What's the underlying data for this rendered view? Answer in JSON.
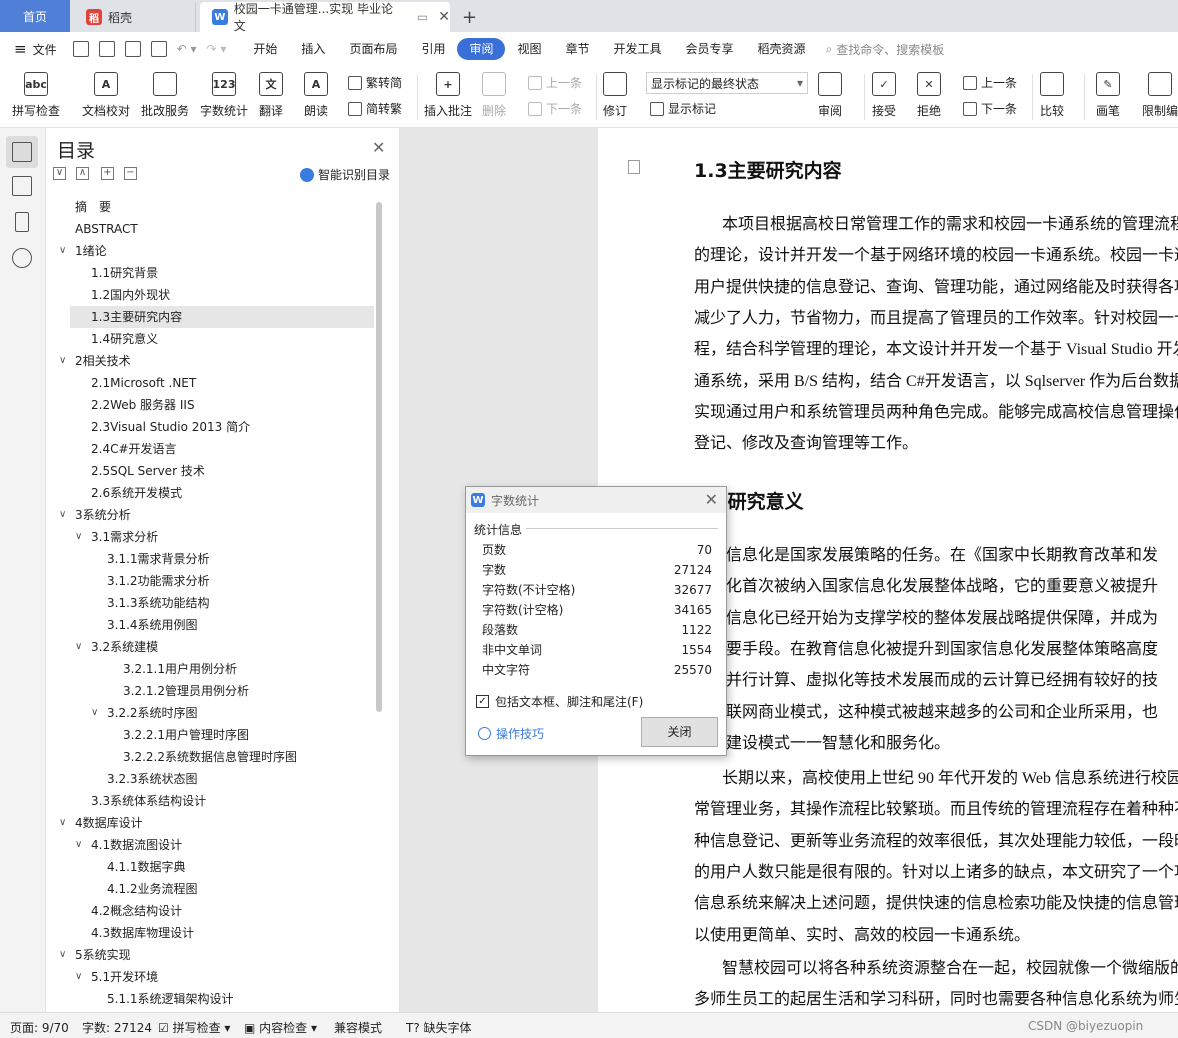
{
  "tabs": {
    "home": "首页",
    "daoke": "稻壳",
    "doc": "校园一卡通管理...实现 毕业论文",
    "add": "+"
  },
  "menubar": {
    "file": "文件",
    "items": [
      "开始",
      "插入",
      "页面布局",
      "引用",
      "审阅",
      "视图",
      "章节",
      "开发工具",
      "会员专享",
      "稻壳资源"
    ],
    "active": "审阅",
    "search": "查找命令、搜索模板"
  },
  "ribbon": {
    "spell": "拼写检查",
    "proof": "文档校对",
    "review_service": "批改服务",
    "word_count": "字数统计",
    "translate": "翻译",
    "read_aloud": "朗读",
    "to_traditional": "繁转简",
    "to_simplified": "简转繁",
    "insert_comment": "插入批注",
    "delete": "删除",
    "prev_comment": "上一条",
    "next_comment": "下一条",
    "track": "修订",
    "markup_select": "显示标记的最终状态",
    "show_markup": "显示标记",
    "review": "审阅",
    "accept": "接受",
    "reject": "拒绝",
    "prev": "上一条",
    "next": "下一条",
    "compare": "比较",
    "pen": "画笔",
    "restrict": "限制编"
  },
  "nav": {
    "title": "目录",
    "smart": "智能识别目录",
    "items": [
      {
        "text": "摘　要",
        "level": 0,
        "arrow": ""
      },
      {
        "text": "ABSTRACT",
        "level": 0,
        "arrow": ""
      },
      {
        "text": "1绪论",
        "level": 0,
        "arrow": "∨"
      },
      {
        "text": "1.1研究背景",
        "level": 1,
        "arrow": ""
      },
      {
        "text": "1.2国内外现状",
        "level": 1,
        "arrow": ""
      },
      {
        "text": "1.3主要研究内容",
        "level": 1,
        "arrow": "",
        "selected": true
      },
      {
        "text": "1.4研究意义",
        "level": 1,
        "arrow": ""
      },
      {
        "text": "2相关技术",
        "level": 0,
        "arrow": "∨"
      },
      {
        "text": "2.1Microsoft .NET",
        "level": 1,
        "arrow": ""
      },
      {
        "text": "2.2Web 服务器 IIS",
        "level": 1,
        "arrow": ""
      },
      {
        "text": "2.3Visual Studio 2013 简介",
        "level": 1,
        "arrow": ""
      },
      {
        "text": "2.4C#开发语言",
        "level": 1,
        "arrow": ""
      },
      {
        "text": "2.5SQL Server 技术",
        "level": 1,
        "arrow": ""
      },
      {
        "text": "2.6系统开发模式",
        "level": 1,
        "arrow": ""
      },
      {
        "text": "3系统分析",
        "level": 0,
        "arrow": "∨"
      },
      {
        "text": "3.1需求分析",
        "level": 1,
        "arrow": "∨"
      },
      {
        "text": "3.1.1需求背景分析",
        "level": 2,
        "arrow": ""
      },
      {
        "text": "3.1.2功能需求分析",
        "level": 2,
        "arrow": ""
      },
      {
        "text": "3.1.3系统功能结构",
        "level": 2,
        "arrow": ""
      },
      {
        "text": "3.1.4系统用例图",
        "level": 2,
        "arrow": ""
      },
      {
        "text": "3.2系统建模",
        "level": 1,
        "arrow": "∨"
      },
      {
        "text": "3.2.1.1用户用例分析",
        "level": 3,
        "arrow": ""
      },
      {
        "text": "3.2.1.2管理员用例分析",
        "level": 3,
        "arrow": ""
      },
      {
        "text": "3.2.2系统时序图",
        "level": 2,
        "arrow": "∨"
      },
      {
        "text": "3.2.2.1用户管理时序图",
        "level": 3,
        "arrow": ""
      },
      {
        "text": "3.2.2.2系统数据信息管理时序图",
        "level": 3,
        "arrow": ""
      },
      {
        "text": "3.2.3系统状态图",
        "level": 2,
        "arrow": ""
      },
      {
        "text": "3.3系统体系结构设计",
        "level": 1,
        "arrow": ""
      },
      {
        "text": "4数据库设计",
        "level": 0,
        "arrow": "∨"
      },
      {
        "text": "4.1数据流图设计",
        "level": 1,
        "arrow": "∨"
      },
      {
        "text": "4.1.1数据字典",
        "level": 2,
        "arrow": ""
      },
      {
        "text": "4.1.2业务流程图",
        "level": 2,
        "arrow": ""
      },
      {
        "text": "4.2概念结构设计",
        "level": 1,
        "arrow": ""
      },
      {
        "text": "4.3数据库物理设计",
        "level": 1,
        "arrow": ""
      },
      {
        "text": "5系统实现",
        "level": 0,
        "arrow": "∨"
      },
      {
        "text": "5.1开发环境",
        "level": 1,
        "arrow": "∨"
      },
      {
        "text": "5.1.1系统逻辑架构设计",
        "level": 2,
        "arrow": ""
      }
    ]
  },
  "doc": {
    "heading1": "1.3主要研究内容",
    "para1": [
      "本项目根据高校日常管理工作的需求和校园一卡通系统的管理流程",
      "的理论，设计并开发一个基于网络环境的校园一卡通系统。校园一卡通",
      "用户提供快捷的信息登记、查询、管理功能，通过网络能及时获得各项",
      "减少了人力，节省物力，而且提高了管理员的工作效率。针对校园一卡",
      "程，结合科学管理的理论，本文设计并开发一个基于 Visual Studio 开发",
      "通系统，采用 B/S 结构，结合 C#开发语言，以 Sqlserver 作为后台数据",
      "实现通过用户和系统管理员两种角色完成。能够完成高校信息管理操作",
      "登记、修改及查询管理等工作。"
    ],
    "heading2": "1.4研究意义",
    "para2": [
      "教育信息化是国家发展策略的任务。在《国家中长期教育改革和发",
      "信息化首次被纳入国家信息化发展整体战略，它的重要意义被提升",
      "教育信息化已经开始为支撑学校的整体发展战略提供保障，并成为",
      "的重要手段。在教育信息化被提升到国家信息化发展整体策略高度",
      "算、并行计算、虚拟化等技术发展而成的云计算已经拥有较好的技",
      "的互联网商业模式，这种模式被越来越多的公司和企业所采用，也",
      "新的建设模式一一智慧化和服务化。"
    ],
    "para3": [
      "长期以来，高校使用上世纪 90 年代开发的 Web 信息系统进行校园",
      "常管理业务，其操作流程比较繁琐。而且传统的管理流程存在着种种不",
      "种信息登记、更新等业务流程的效率很低，其次处理能力较低，一段时",
      "的用户人数只能是很有限的。针对以上诸多的缺点，本文研究了一个功",
      "信息系统来解决上述问题，提供快速的信息检索功能及快捷的信息管理",
      "以使用更简单、实时、高效的校园一卡通系统。"
    ],
    "para4": [
      "智慧校园可以将各种系统资源整合在一起，校园就像一个微缩版的",
      "多师生员工的起居生活和学习科研，同时也需要各种信息化系统为师生"
    ]
  },
  "dialog": {
    "title": "字数统计",
    "section": "统计信息",
    "stats": [
      {
        "label": "页数",
        "value": "70"
      },
      {
        "label": "字数",
        "value": "27124"
      },
      {
        "label": "字符数(不计空格)",
        "value": "32677"
      },
      {
        "label": "字符数(计空格)",
        "value": "34165"
      },
      {
        "label": "段落数",
        "value": "1122"
      },
      {
        "label": "非中文单词",
        "value": "1554"
      },
      {
        "label": "中文字符",
        "value": "25570"
      }
    ],
    "checkbox": "包括文本框、脚注和尾注(F)",
    "tips": "操作技巧",
    "close": "关闭"
  },
  "status": {
    "page": "页面: 9/70",
    "words": "字数: 27124",
    "spell": "拼写检查",
    "content_check": "内容检查",
    "compat": "兼容模式",
    "missing_font": "缺失字体",
    "watermark": "CSDN @biyezuopin"
  },
  "colors": {
    "accent": "#3a6fd8",
    "home_tab": "#4f7fd6",
    "daoke_red": "#e0433a",
    "wps_blue": "#3a7be0"
  }
}
